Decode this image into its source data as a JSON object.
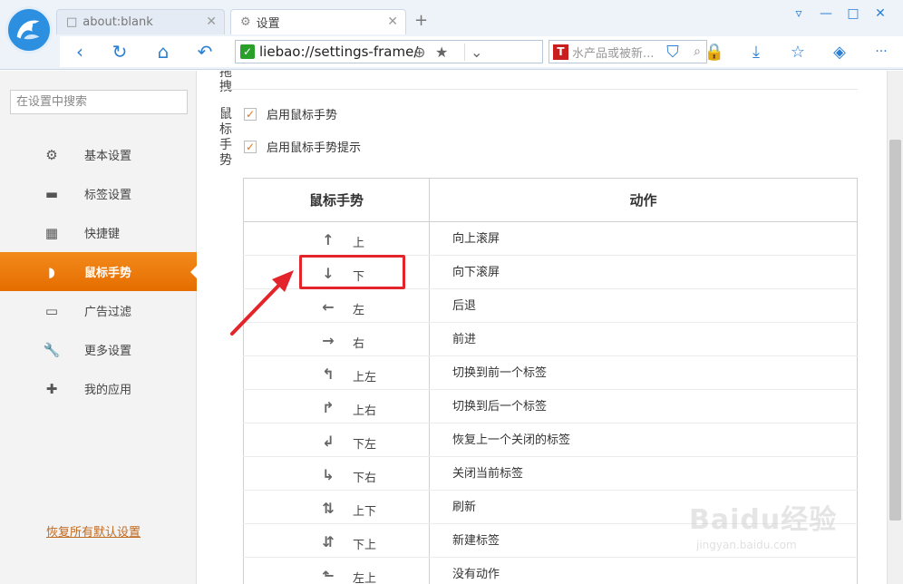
{
  "window": {
    "tabs": [
      {
        "label": "about:blank",
        "icon": "page-icon"
      },
      {
        "label": "设置",
        "icon": "gear-icon"
      }
    ],
    "new_tab": "+",
    "controls": [
      "shirt-icon",
      "minimize-icon",
      "maximize-icon",
      "close-icon"
    ]
  },
  "toolbar": {
    "url": "liebao://settings-frame/",
    "search_placeholder": "水产品或被新...",
    "search_engine_badge": "T"
  },
  "sidebar": {
    "search_placeholder": "在设置中搜索",
    "items": [
      {
        "label": "基本设置",
        "icon": "gear-icon"
      },
      {
        "label": "标签设置",
        "icon": "tab-icon"
      },
      {
        "label": "快捷键",
        "icon": "keyboard-icon"
      },
      {
        "label": "鼠标手势",
        "icon": "mouse-icon",
        "active": true
      },
      {
        "label": "广告过滤",
        "icon": "window-icon"
      },
      {
        "label": "更多设置",
        "icon": "wrench-icon"
      },
      {
        "label": "我的应用",
        "icon": "puzzle-icon"
      }
    ],
    "restore_link": "恢复所有默认设置"
  },
  "main": {
    "prev_section_title": "拖拽",
    "section_title": "鼠标手势",
    "checkboxes": [
      {
        "label": "启用鼠标手势",
        "checked": true
      },
      {
        "label": "启用鼠标手势提示",
        "checked": true
      }
    ],
    "table": {
      "headers": [
        "鼠标手势",
        "动作"
      ],
      "rows": [
        {
          "gesture": "上",
          "icon": "arrow-up-icon",
          "action": "向上滚屏"
        },
        {
          "gesture": "下",
          "icon": "arrow-down-icon",
          "action": "向下滚屏"
        },
        {
          "gesture": "左",
          "icon": "arrow-left-icon",
          "action": "后退"
        },
        {
          "gesture": "右",
          "icon": "arrow-right-icon",
          "action": "前进"
        },
        {
          "gesture": "上左",
          "icon": "arrow-up-left-icon",
          "action": "切换到前一个标签"
        },
        {
          "gesture": "上右",
          "icon": "arrow-up-right-icon",
          "action": "切换到后一个标签"
        },
        {
          "gesture": "下左",
          "icon": "arrow-down-left-icon",
          "action": "恢复上一个关闭的标签"
        },
        {
          "gesture": "下右",
          "icon": "arrow-down-right-icon",
          "action": "关闭当前标签"
        },
        {
          "gesture": "上下",
          "icon": "arrow-up-down-icon",
          "action": "刷新"
        },
        {
          "gesture": "下上",
          "icon": "arrow-down-up-icon",
          "action": "新建标签"
        },
        {
          "gesture": "左上",
          "icon": "arrow-left-up-icon",
          "action": "没有动作"
        }
      ]
    }
  },
  "watermark": {
    "brand": "Baidu经验",
    "url": "jingyan.baidu.com"
  },
  "colors": {
    "accent": "#e87a12",
    "highlight": "#e3242b",
    "link": "#c06a20",
    "chrome_blue": "#2a7fd3"
  }
}
